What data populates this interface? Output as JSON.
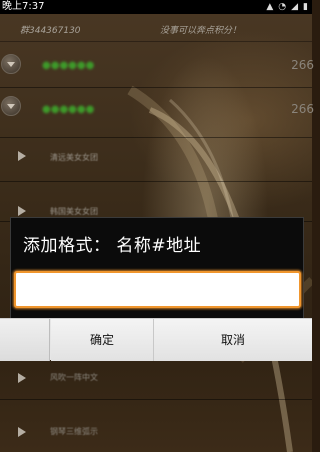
{
  "status_bar": {
    "time": "晚上7:37",
    "icons": [
      "signal-icon",
      "wifi-icon",
      "battery-icon"
    ]
  },
  "header": {
    "left_text": "群344367130",
    "right_text": "没事可以奔点积分！"
  },
  "list": {
    "rows": [
      {
        "name": "●●●●●●",
        "count": "266"
      },
      {
        "name": "●●●●●●",
        "count": "266"
      }
    ],
    "sub_items": [
      "清远美女女团",
      "韩国美女女团",
      "风吹一阵中文",
      "钢琴三维弧示"
    ]
  },
  "dialog": {
    "title": "添加格式： 名称#地址",
    "input_value": "",
    "input_placeholder": ""
  },
  "buttons": {
    "ok_label": "确定",
    "cancel_label": "取消"
  },
  "colors": {
    "accent": "#f0962e",
    "dialog_bg": "#0b0b0b",
    "button_bar": "#e6e6e6"
  }
}
